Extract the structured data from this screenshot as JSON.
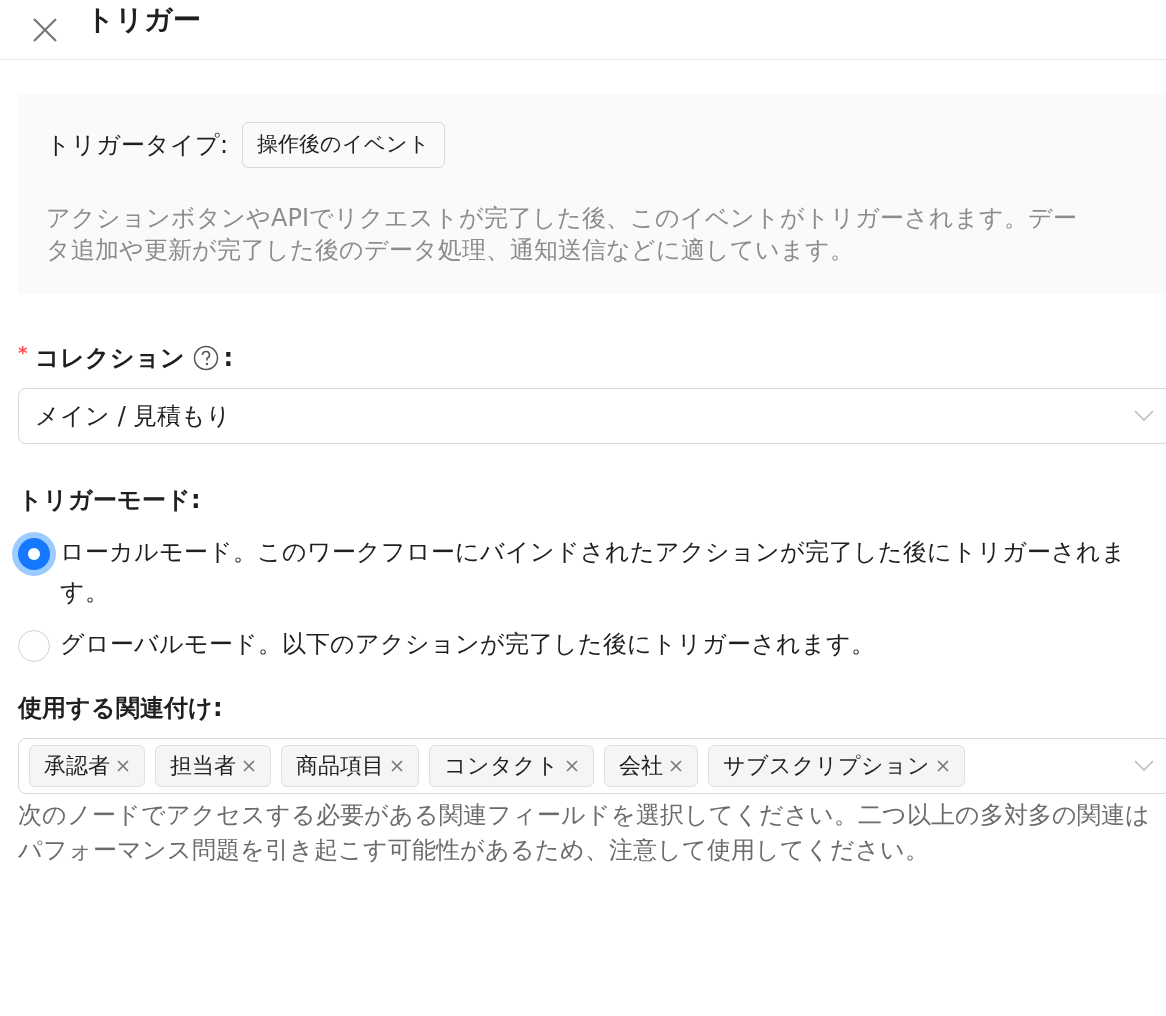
{
  "header": {
    "title": "トリガー"
  },
  "trigger_info": {
    "label": "トリガータイプ:",
    "type": "操作後のイベント",
    "description": "アクションボタンやAPIでリクエストが完了した後、このイベントがトリガーされます。データ追加や更新が完了した後のデータ処理、通知送信などに適しています。"
  },
  "collection": {
    "required_mark": "*",
    "label": "コレクション",
    "suffix": ":",
    "value": "メイン / 見積もり"
  },
  "trigger_mode": {
    "label": "トリガーモード:",
    "options": [
      {
        "label": "ローカルモード。このワークフローにバインドされたアクションが完了した後にトリガーされます。",
        "selected": true
      },
      {
        "label": "グローバルモード。以下のアクションが完了した後にトリガーされます。",
        "selected": false
      }
    ]
  },
  "associations": {
    "label": "使用する関連付け:",
    "tags": [
      "承認者",
      "担当者",
      "商品項目",
      "コンタクト",
      "会社",
      "サブスクリプション"
    ],
    "help": "次のノードでアクセスする必要がある関連フィールドを選択してください。二つ以上の多対多の関連はパフォーマンス問題を引き起こす可能性があるため、注意して使用してください。"
  }
}
